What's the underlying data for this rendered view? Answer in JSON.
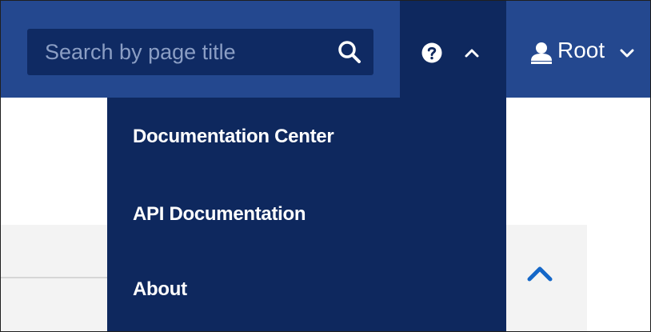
{
  "search": {
    "placeholder": "Search by page title",
    "icon": "search-icon"
  },
  "header": {
    "help_icon": "question-circle-icon",
    "help_chevron_icon": "chevron-up-icon",
    "user": {
      "icon": "user-icon",
      "label": "Root",
      "chevron_icon": "chevron-down-icon"
    }
  },
  "help_menu": {
    "items": [
      {
        "label": "Documentation Center"
      },
      {
        "label": "API Documentation"
      },
      {
        "label": "About"
      }
    ]
  },
  "content": {
    "collapse_icon": "chevron-up-icon"
  },
  "colors": {
    "header_bg": "#24488f",
    "menu_bg": "#0e285e",
    "search_bg": "#0f2a63",
    "accent": "#1467c8"
  }
}
